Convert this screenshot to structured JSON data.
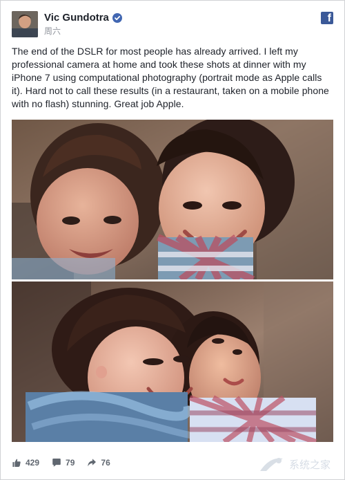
{
  "post": {
    "author": "Vic Gundotra",
    "timestamp": "周六",
    "text": "The end of the DSLR for most people has already arrived. I left my professional camera at home and took these shots at dinner with my iPhone 7 using computational photography (portrait mode as Apple calls it). Hard not to call these results (in a restaurant, taken on a mobile phone with no flash) stunning. Great job Apple.",
    "verified_icon": "verified-badge-icon",
    "brand_icon": "facebook-icon",
    "photos": [
      {
        "name": "photo-children-smiling"
      },
      {
        "name": "photo-children-laughing"
      }
    ]
  },
  "engagement": {
    "likes": "429",
    "comments": "79",
    "shares": "76"
  },
  "watermark": {
    "text": "系统之家"
  },
  "colors": {
    "brand": "#3b5998",
    "verified": "#4267b2",
    "text": "#1d2129",
    "muted": "#90949c",
    "engagement": "#606770"
  }
}
